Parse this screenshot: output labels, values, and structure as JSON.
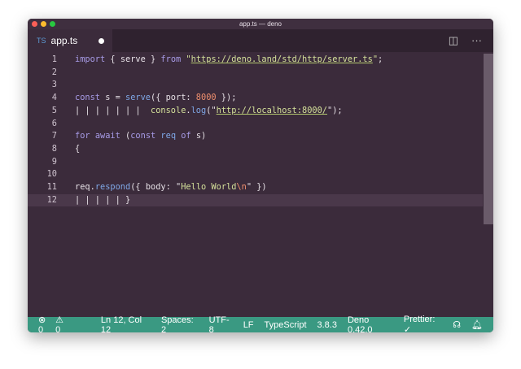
{
  "window": {
    "title": "app.ts — deno"
  },
  "tab": {
    "lang": "TS",
    "name": "app.ts"
  },
  "toolbar": {
    "split": "◫",
    "more": "···"
  },
  "lines": [
    {
      "n": "1",
      "t": [
        [
          "import",
          "kw"
        ],
        [
          " { ",
          "id"
        ],
        [
          "serve",
          "id"
        ],
        [
          " } ",
          "id"
        ],
        [
          "from",
          "kw"
        ],
        [
          " \"",
          "str"
        ],
        [
          "https://deno.land/std/http/server.ts",
          "url"
        ],
        [
          "\"",
          "str"
        ],
        [
          ";",
          "id"
        ]
      ]
    },
    {
      "n": "2",
      "t": []
    },
    {
      "n": "3",
      "t": []
    },
    {
      "n": "4",
      "t": [
        [
          "const",
          "kw"
        ],
        [
          " s = ",
          "id"
        ],
        [
          "serve",
          "fn"
        ],
        [
          "({ port: ",
          "id"
        ],
        [
          "8000",
          "num"
        ],
        [
          " });",
          "id"
        ]
      ]
    },
    {
      "n": "5",
      "t": [
        [
          "| | | | | | |  ",
          "guide"
        ],
        [
          "console",
          "str"
        ],
        [
          ".",
          "id"
        ],
        [
          "log",
          "fn"
        ],
        [
          "(\"",
          "id"
        ],
        [
          "http://localhost:8000/",
          "url"
        ],
        [
          "\");",
          "id"
        ]
      ]
    },
    {
      "n": "6",
      "t": []
    },
    {
      "n": "7",
      "t": [
        [
          "for",
          "kw"
        ],
        [
          " ",
          "id"
        ],
        [
          "await",
          "kw"
        ],
        [
          " (",
          "id"
        ],
        [
          "const",
          "kw"
        ],
        [
          " ",
          "id"
        ],
        [
          "req",
          "fn"
        ],
        [
          " ",
          "id"
        ],
        [
          "of",
          "kw"
        ],
        [
          " s)",
          "id"
        ]
      ]
    },
    {
      "n": "8",
      "t": [
        [
          "{",
          "id"
        ]
      ]
    },
    {
      "n": "9",
      "t": []
    },
    {
      "n": "10",
      "t": []
    },
    {
      "n": "11",
      "t": [
        [
          "req.",
          "id"
        ],
        [
          "respond",
          "fn"
        ],
        [
          "({ body: \"",
          "id"
        ],
        [
          "Hello World",
          "str"
        ],
        [
          "\\n",
          "esc"
        ],
        [
          "\" })",
          "id"
        ]
      ]
    },
    {
      "n": "12",
      "t": [
        [
          "| | | | | ",
          "guide"
        ],
        [
          "}",
          "id"
        ]
      ]
    }
  ],
  "status": {
    "errors": "⊗ 0",
    "warnings": "⚠ 0",
    "position": "Ln 12, Col 12",
    "spaces": "Spaces: 2",
    "encoding": "UTF-8",
    "eol": "LF",
    "language": "TypeScript",
    "version": "3.8.3",
    "deno": "Deno 0.42.0",
    "prettier": "Prettier: ✓",
    "feedback": "☊",
    "bell": "🔔︎"
  }
}
